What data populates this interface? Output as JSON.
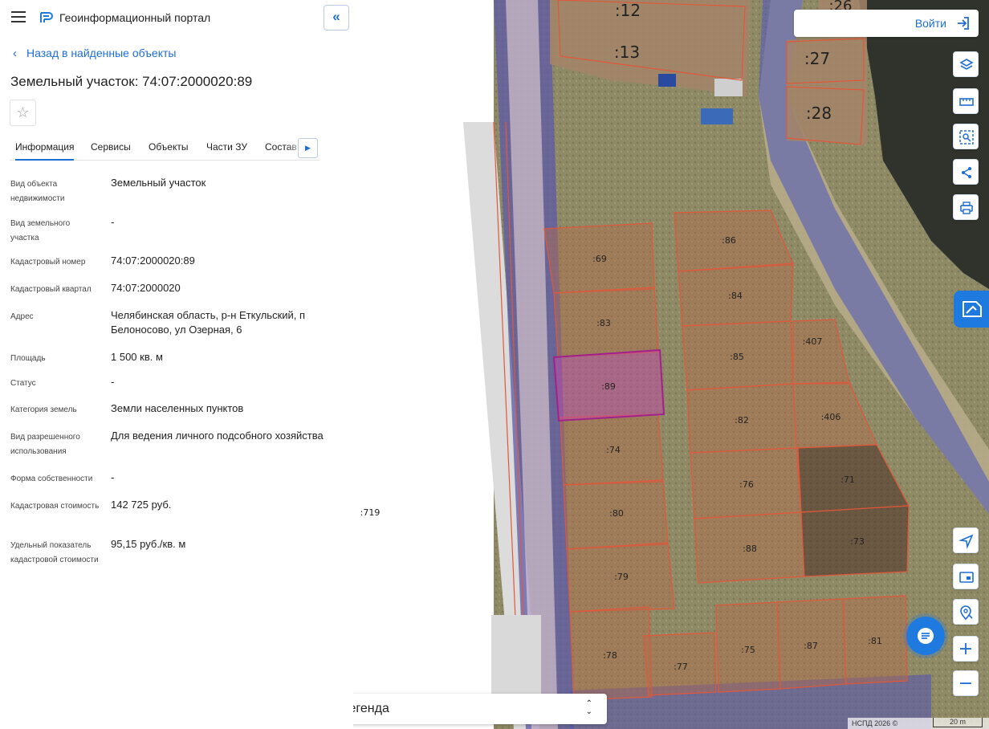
{
  "header": {
    "app_title": "Геоинформационный портал",
    "collapse_label": "«"
  },
  "back_link": "Назад в найденные объекты",
  "object_title": "Земельный участок: 74:07:2000020:89",
  "favorite_icon": "☆",
  "tabs": [
    {
      "label": "Информация",
      "active": true
    },
    {
      "label": "Сервисы"
    },
    {
      "label": "Объекты"
    },
    {
      "label": "Части ЗУ"
    },
    {
      "label": "Состав"
    }
  ],
  "properties": [
    {
      "label": "Вид объекта недвижимости",
      "value": "Земельный участок"
    },
    {
      "label": "Вид земельного участка",
      "value": "-"
    },
    {
      "label": "Кадастровый номер",
      "value": "74:07:2000020:89"
    },
    {
      "label": "Кадастровый квартал",
      "value": "74:07:2000020"
    },
    {
      "label": "Адрес",
      "value": "Челябинская область, р-н Еткульский, п Белоносово, ул Озерная, 6"
    },
    {
      "label": "Площадь",
      "value": "1 500 кв. м"
    },
    {
      "label": "Статус",
      "value": "-"
    },
    {
      "label": "Категория земель",
      "value": "Земли населенных пунктов"
    },
    {
      "label": "Вид разрешенного использования",
      "value": "Для ведения личного подсобного хозяйства"
    },
    {
      "label": "Форма собственности",
      "value": "-"
    },
    {
      "label": "Кадастровая стоимость",
      "value": "142 725 руб."
    },
    {
      "label": "Удельный показатель кадастровой стоимости",
      "value": "95,15 руб./кв. м"
    }
  ],
  "map": {
    "login_label": "Войти",
    "legend_label": "Легенда",
    "attribution": "НСПД 2026 ©",
    "scale_label": "20 m",
    "highlight_color": "#a0228c",
    "parcel_color": "#e2573a",
    "plot_labels": [
      ":12",
      ":13",
      ":26",
      ":27",
      ":28",
      ":69",
      ":83",
      ":89",
      ":74",
      ":80",
      ":79",
      ":78",
      ":77",
      ":86",
      ":84",
      ":85",
      ":82",
      ":76",
      ":88",
      ":75",
      ":87",
      ":81",
      ":407",
      ":406",
      ":71",
      ":73",
      ":719"
    ]
  },
  "toolbar": [
    {
      "name": "layers-icon"
    },
    {
      "name": "ruler-icon"
    },
    {
      "name": "select-area-icon"
    },
    {
      "name": "share-icon"
    },
    {
      "name": "print-icon"
    },
    {
      "name": "geolocate-icon"
    },
    {
      "name": "minimap-icon"
    },
    {
      "name": "search-location-icon"
    },
    {
      "name": "zoom-in-icon",
      "label": "+"
    },
    {
      "name": "zoom-out-icon",
      "label": "−"
    }
  ]
}
